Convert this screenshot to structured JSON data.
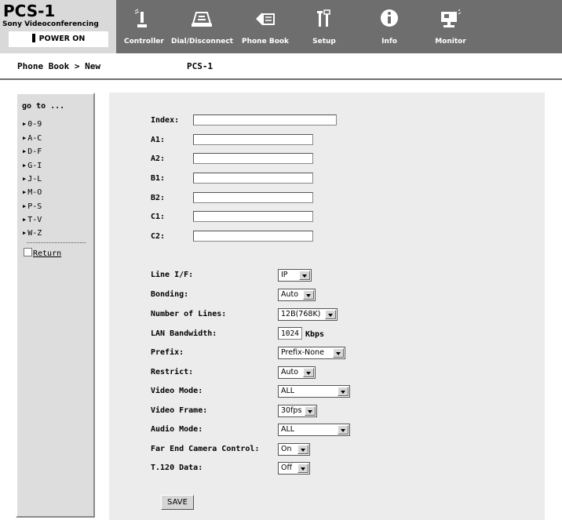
{
  "brand": {
    "product": "PCS-1",
    "subtitle": "Sony Videoconferencing",
    "power": "POWER ON"
  },
  "nav": [
    {
      "label": "Controller",
      "icon": "controller-icon"
    },
    {
      "label": "Dial/Disconnect",
      "icon": "dial-icon"
    },
    {
      "label": "Phone Book",
      "icon": "phone-book-icon"
    },
    {
      "label": "Setup",
      "icon": "setup-icon"
    },
    {
      "label": "Info",
      "icon": "info-icon"
    },
    {
      "label": "Monitor",
      "icon": "monitor-icon"
    }
  ],
  "breadcrumb": "Phone Book > New",
  "page_title": "PCS-1",
  "sidebar": {
    "goto": "go to ...",
    "items": [
      "0-9",
      "A-C",
      "D-F",
      "G-I",
      "J-L",
      "M-O",
      "P-S",
      "T-V",
      "W-Z"
    ],
    "return": "Return"
  },
  "form": {
    "index": {
      "label": "Index:",
      "value": ""
    },
    "a1": {
      "label": "A1:",
      "value": ""
    },
    "a2": {
      "label": "A2:",
      "value": ""
    },
    "b1": {
      "label": "B1:",
      "value": ""
    },
    "b2": {
      "label": "B2:",
      "value": ""
    },
    "c1": {
      "label": "C1:",
      "value": ""
    },
    "c2": {
      "label": "C2:",
      "value": ""
    },
    "line_if": {
      "label": "Line I/F:",
      "value": "IP"
    },
    "bonding": {
      "label": "Bonding:",
      "value": "Auto"
    },
    "num_lines": {
      "label": "Number of Lines:",
      "value": "12B(768K)"
    },
    "lan_bw": {
      "label": "LAN Bandwidth:",
      "value": "1024",
      "unit": "Kbps"
    },
    "prefix": {
      "label": "Prefix:",
      "value": "Prefix-None"
    },
    "restrict": {
      "label": "Restrict:",
      "value": "Auto"
    },
    "video_mode": {
      "label": "Video Mode:",
      "value": "ALL"
    },
    "video_frame": {
      "label": "Video Frame:",
      "value": "30fps"
    },
    "audio_mode": {
      "label": "Audio Mode:",
      "value": "ALL"
    },
    "fecc": {
      "label": "Far End Camera Control:",
      "value": "On"
    },
    "t120": {
      "label": "T.120 Data:",
      "value": "Off"
    },
    "save": "SAVE"
  },
  "colors": {
    "header": "#6e6e6e",
    "panel": "#ececec",
    "sidebar": "#dddddd"
  }
}
